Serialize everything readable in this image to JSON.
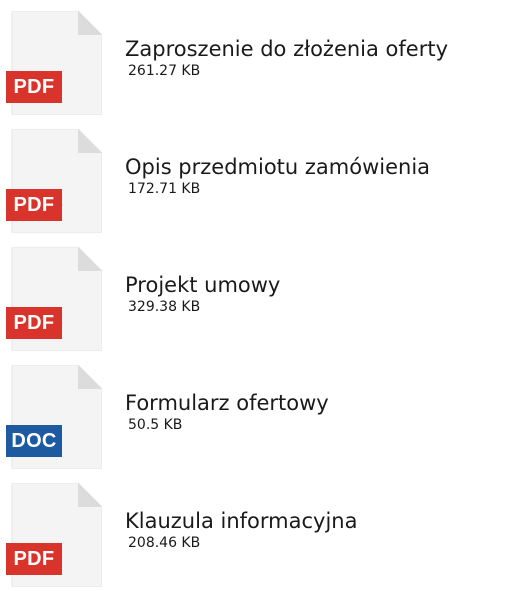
{
  "files": [
    {
      "name": "Zaproszenie do złożenia oferty",
      "size": "261.27 KB",
      "type": "PDF",
      "icon": "pdf-file-icon"
    },
    {
      "name": "Opis przedmiotu zamówienia",
      "size": "172.71 KB",
      "type": "PDF",
      "icon": "pdf-file-icon"
    },
    {
      "name": "Projekt umowy",
      "size": "329.38 KB",
      "type": "PDF",
      "icon": "pdf-file-icon"
    },
    {
      "name": "Formularz ofertowy",
      "size": "50.5 KB",
      "type": "DOC",
      "icon": "doc-file-icon"
    },
    {
      "name": "Klauzula informacyjna",
      "size": "208.46 KB",
      "type": "PDF",
      "icon": "pdf-file-icon"
    }
  ],
  "colors": {
    "pdf_badge": "#d9342b",
    "doc_badge": "#1e5aa0",
    "page_fill": "#f4f4f4",
    "page_fold": "#dcdcdc"
  }
}
